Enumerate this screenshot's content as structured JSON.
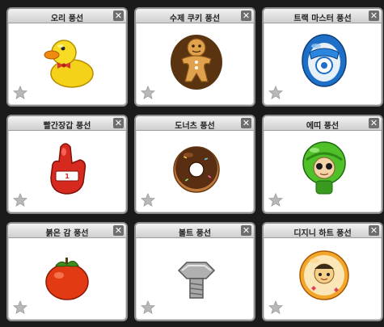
{
  "cards": [
    {
      "title": "오리 풍선",
      "close": "✕",
      "icon": "duck-balloon-icon"
    },
    {
      "title": "수제 쿠키 풍선",
      "close": "✕",
      "icon": "cookie-balloon-icon"
    },
    {
      "title": "트랙 마스터 풍선",
      "close": "✕",
      "icon": "track-master-balloon-icon"
    },
    {
      "title": "빨간장갑 풍선",
      "close": "✕",
      "icon": "red-glove-balloon-icon"
    },
    {
      "title": "도너츠 풍선",
      "close": "✕",
      "icon": "donut-balloon-icon"
    },
    {
      "title": "에띠 풍선",
      "close": "✕",
      "icon": "etti-balloon-icon"
    },
    {
      "title": "붉은 감 풍선",
      "close": "✕",
      "icon": "persimmon-balloon-icon"
    },
    {
      "title": "볼트 풍선",
      "close": "✕",
      "icon": "bolt-balloon-icon"
    },
    {
      "title": "디지니 하트 풍선",
      "close": "✕",
      "icon": "dizni-heart-balloon-icon"
    }
  ],
  "colors": {
    "header_bg": "#dcdcdc",
    "close_bg": "#6e6e6e",
    "star": "#b8b8b8",
    "border": "#8d8d8d"
  }
}
